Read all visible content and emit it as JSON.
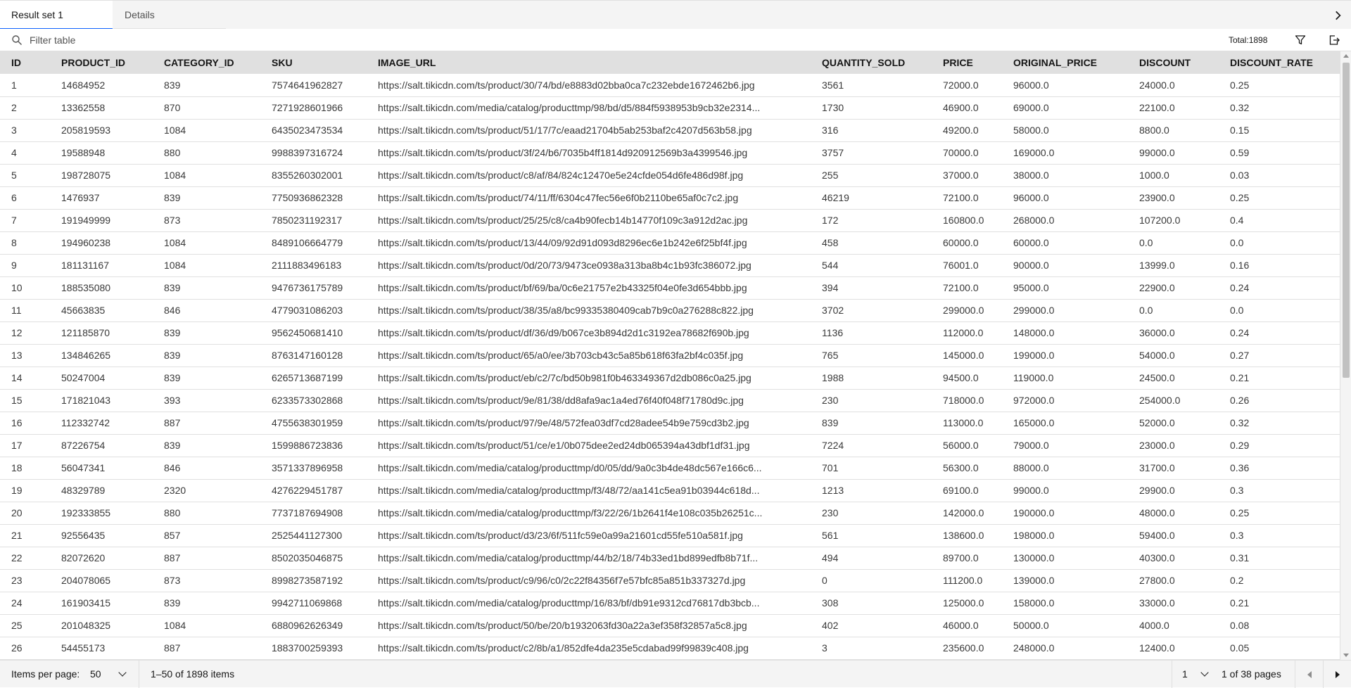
{
  "tabs": [
    {
      "label": "Result set 1",
      "active": true
    },
    {
      "label": "Details",
      "active": false
    }
  ],
  "toolbar": {
    "filter_placeholder": "Filter table",
    "total_label": "Total:",
    "total_value": "1898",
    "icons": [
      "search-icon",
      "filter-icon",
      "export-icon"
    ]
  },
  "table": {
    "columns": [
      "ID",
      "PRODUCT_ID",
      "CATEGORY_ID",
      "SKU",
      "IMAGE_URL",
      "QUANTITY_SOLD",
      "PRICE",
      "ORIGINAL_PRICE",
      "DISCOUNT",
      "DISCOUNT_RATE"
    ],
    "rows": [
      [
        "1",
        "14684952",
        "839",
        "7574641962827",
        "https://salt.tikicdn.com/ts/product/30/74/bd/e8883d02bba0ca7c232ebde1672462b6.jpg",
        "3561",
        "72000.0",
        "96000.0",
        "24000.0",
        "0.25"
      ],
      [
        "2",
        "13362558",
        "870",
        "7271928601966",
        "https://salt.tikicdn.com/media/catalog/producttmp/98/bd/d5/884f5938953b9cb32e2314...",
        "1730",
        "46900.0",
        "69000.0",
        "22100.0",
        "0.32"
      ],
      [
        "3",
        "205819593",
        "1084",
        "6435023473534",
        "https://salt.tikicdn.com/ts/product/51/17/7c/eaad21704b5ab253baf2c4207d563b58.jpg",
        "316",
        "49200.0",
        "58000.0",
        "8800.0",
        "0.15"
      ],
      [
        "4",
        "19588948",
        "880",
        "9988397316724",
        "https://salt.tikicdn.com/ts/product/3f/24/b6/7035b4ff1814d920912569b3a4399546.jpg",
        "3757",
        "70000.0",
        "169000.0",
        "99000.0",
        "0.59"
      ],
      [
        "5",
        "198728075",
        "1084",
        "8355260302001",
        "https://salt.tikicdn.com/ts/product/c8/af/84/824c12470e5e24cfde054d6fe486d98f.jpg",
        "255",
        "37000.0",
        "38000.0",
        "1000.0",
        "0.03"
      ],
      [
        "6",
        "1476937",
        "839",
        "7750936862328",
        "https://salt.tikicdn.com/ts/product/74/11/ff/6304c47fec56e6f0b2110be65af0c7c2.jpg",
        "46219",
        "72100.0",
        "96000.0",
        "23900.0",
        "0.25"
      ],
      [
        "7",
        "191949999",
        "873",
        "7850231192317",
        "https://salt.tikicdn.com/ts/product/25/25/c8/ca4b90fecb14b14770f109c3a912d2ac.jpg",
        "172",
        "160800.0",
        "268000.0",
        "107200.0",
        "0.4"
      ],
      [
        "8",
        "194960238",
        "1084",
        "8489106664779",
        "https://salt.tikicdn.com/ts/product/13/44/09/92d91d093d8296ec6e1b242e6f25bf4f.jpg",
        "458",
        "60000.0",
        "60000.0",
        "0.0",
        "0.0"
      ],
      [
        "9",
        "181131167",
        "1084",
        "2111883496183",
        "https://salt.tikicdn.com/ts/product/0d/20/73/9473ce0938a313ba8b4c1b93fc386072.jpg",
        "544",
        "76001.0",
        "90000.0",
        "13999.0",
        "0.16"
      ],
      [
        "10",
        "188535080",
        "839",
        "9476736175789",
        "https://salt.tikicdn.com/ts/product/bf/69/ba/0c6e21757e2b43325f04e0fe3d654bbb.jpg",
        "394",
        "72100.0",
        "95000.0",
        "22900.0",
        "0.24"
      ],
      [
        "11",
        "45663835",
        "846",
        "4779031086203",
        "https://salt.tikicdn.com/ts/product/38/35/a8/bc99335380409cab7b9c0a276288c822.jpg",
        "3702",
        "299000.0",
        "299000.0",
        "0.0",
        "0.0"
      ],
      [
        "12",
        "121185870",
        "839",
        "9562450681410",
        "https://salt.tikicdn.com/ts/product/df/36/d9/b067ce3b894d2d1c3192ea78682f690b.jpg",
        "1136",
        "112000.0",
        "148000.0",
        "36000.0",
        "0.24"
      ],
      [
        "13",
        "134846265",
        "839",
        "8763147160128",
        "https://salt.tikicdn.com/ts/product/65/a0/ee/3b703cb43c5a85b618f63fa2bf4c035f.jpg",
        "765",
        "145000.0",
        "199000.0",
        "54000.0",
        "0.27"
      ],
      [
        "14",
        "50247004",
        "839",
        "6265713687199",
        "https://salt.tikicdn.com/ts/product/eb/c2/7c/bd50b981f0b463349367d2db086c0a25.jpg",
        "1988",
        "94500.0",
        "119000.0",
        "24500.0",
        "0.21"
      ],
      [
        "15",
        "171821043",
        "393",
        "6233573302868",
        "https://salt.tikicdn.com/ts/product/9e/81/38/dd8afa9ac1a4ed76f40f048f71780d9c.jpg",
        "230",
        "718000.0",
        "972000.0",
        "254000.0",
        "0.26"
      ],
      [
        "16",
        "112332742",
        "887",
        "4755638301959",
        "https://salt.tikicdn.com/ts/product/97/9e/48/572fea03df7cd28adee54b9e759cd3b2.jpg",
        "839",
        "113000.0",
        "165000.0",
        "52000.0",
        "0.32"
      ],
      [
        "17",
        "87226754",
        "839",
        "1599886723836",
        "https://salt.tikicdn.com/ts/product/51/ce/e1/0b075dee2ed24db065394a43dbf1df31.jpg",
        "7224",
        "56000.0",
        "79000.0",
        "23000.0",
        "0.29"
      ],
      [
        "18",
        "56047341",
        "846",
        "3571337896958",
        "https://salt.tikicdn.com/media/catalog/producttmp/d0/05/dd/9a0c3b4de48dc567e166c6...",
        "701",
        "56300.0",
        "88000.0",
        "31700.0",
        "0.36"
      ],
      [
        "19",
        "48329789",
        "2320",
        "4276229451787",
        "https://salt.tikicdn.com/media/catalog/producttmp/f3/48/72/aa141c5ea91b03944c618d...",
        "1213",
        "69100.0",
        "99000.0",
        "29900.0",
        "0.3"
      ],
      [
        "20",
        "192333855",
        "880",
        "7737187694908",
        "https://salt.tikicdn.com/media/catalog/producttmp/f3/22/26/1b2641f4e108c035b26251c...",
        "230",
        "142000.0",
        "190000.0",
        "48000.0",
        "0.25"
      ],
      [
        "21",
        "92556435",
        "857",
        "2525441127300",
        "https://salt.tikicdn.com/ts/product/d3/23/6f/511fc59e0a99a21601cd55fe510a581f.jpg",
        "561",
        "138600.0",
        "198000.0",
        "59400.0",
        "0.3"
      ],
      [
        "22",
        "82072620",
        "887",
        "8502035046875",
        "https://salt.tikicdn.com/media/catalog/producttmp/44/b2/18/74b33ed1bd899edfb8b71f...",
        "494",
        "89700.0",
        "130000.0",
        "40300.0",
        "0.31"
      ],
      [
        "23",
        "204078065",
        "873",
        "8998273587192",
        "https://salt.tikicdn.com/ts/product/c9/96/c0/2c22f84356f7e57bfc85a851b337327d.jpg",
        "0",
        "111200.0",
        "139000.0",
        "27800.0",
        "0.2"
      ],
      [
        "24",
        "161903415",
        "839",
        "9942711069868",
        "https://salt.tikicdn.com/media/catalog/producttmp/16/83/bf/db91e9312cd76817db3bcb...",
        "308",
        "125000.0",
        "158000.0",
        "33000.0",
        "0.21"
      ],
      [
        "25",
        "201048325",
        "1084",
        "6880962626349",
        "https://salt.tikicdn.com/ts/product/50/be/20/b1932063fd30a22a3ef358f32857a5c8.jpg",
        "402",
        "46000.0",
        "50000.0",
        "4000.0",
        "0.08"
      ],
      [
        "26",
        "54455173",
        "887",
        "1883700259393",
        "https://salt.tikicdn.com/ts/product/c2/8b/a1/852dfe4da235e5cdabad99f99839c408.jpg",
        "3",
        "235600.0",
        "248000.0",
        "12400.0",
        "0.05"
      ]
    ]
  },
  "pagination": {
    "items_per_page_label": "Items per page:",
    "items_per_page_value": "50",
    "range_text": "1–50 of 1898 items",
    "page_value": "1",
    "page_of_text": "1 of 38 pages"
  }
}
